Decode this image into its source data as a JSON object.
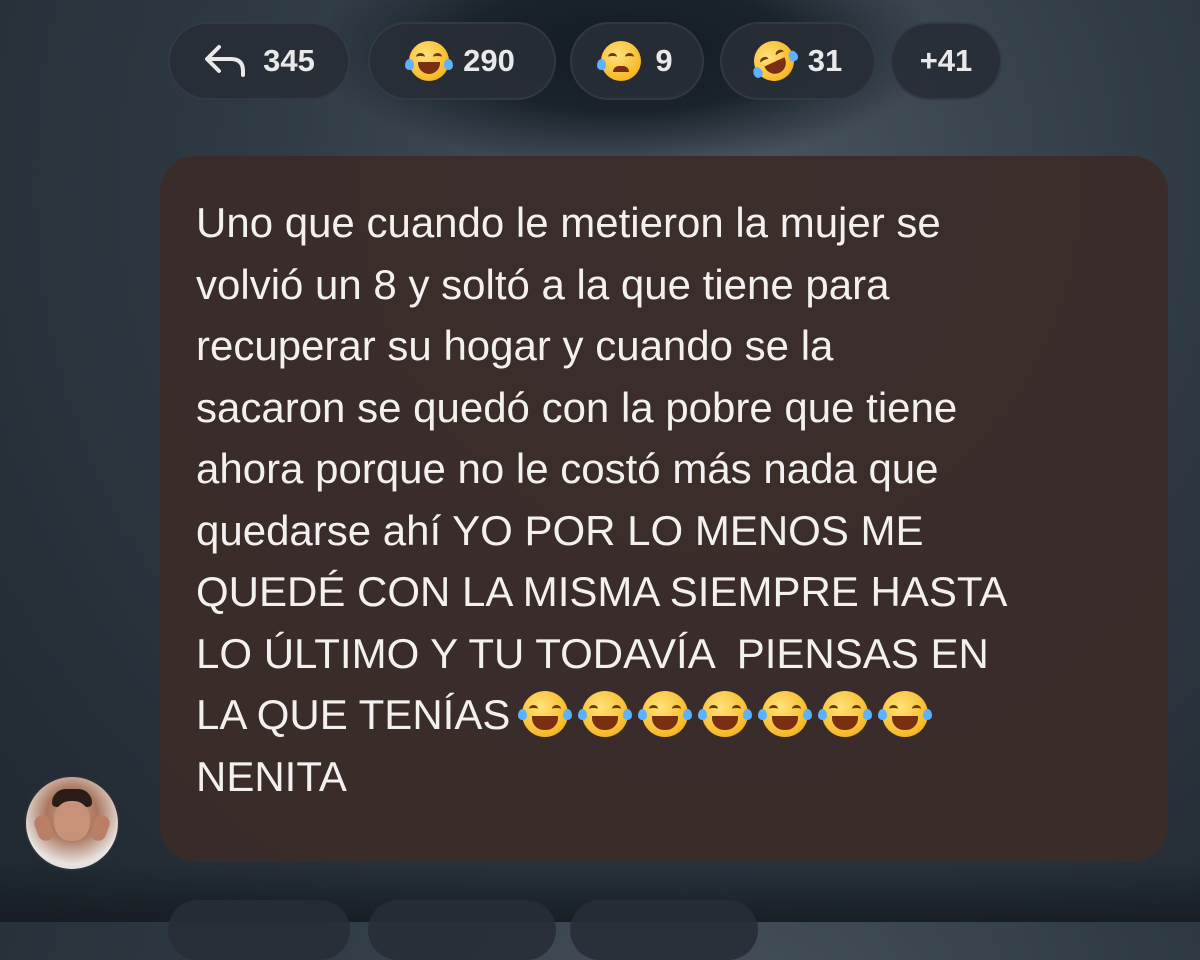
{
  "reactions": {
    "reply_count": "345",
    "items": [
      {
        "icon": "tears-of-joy-emoji",
        "count": "290"
      },
      {
        "icon": "crying-emoji",
        "count": "9"
      },
      {
        "icon": "rofl-emoji",
        "count": "31"
      }
    ],
    "more": "+41"
  },
  "message": {
    "lines": [
      "Uno que cuando le metieron la mujer se",
      "volvió un 8 y soltó a la que tiene para",
      "recuperar su hogar y cuando se la",
      "sacaron se quedó con la pobre que tiene",
      "ahora porque no le costó más nada que",
      "quedarse ahí YO POR LO MENOS ME",
      "QUEDÉ CON LA MISMA SIEMPRE HASTA",
      "LO ÚLTIMO Y TU TODAVÍA  PIENSAS EN",
      "LA QUE TENÍAS ",
      "NENITA"
    ],
    "trailing_emoji": "tears-of-joy-emoji",
    "trailing_emoji_count": 7
  },
  "colors": {
    "bubble": "#3a2c28",
    "text": "#f3f1ef",
    "pill": "#282e36",
    "emoji": "#f7b928"
  }
}
